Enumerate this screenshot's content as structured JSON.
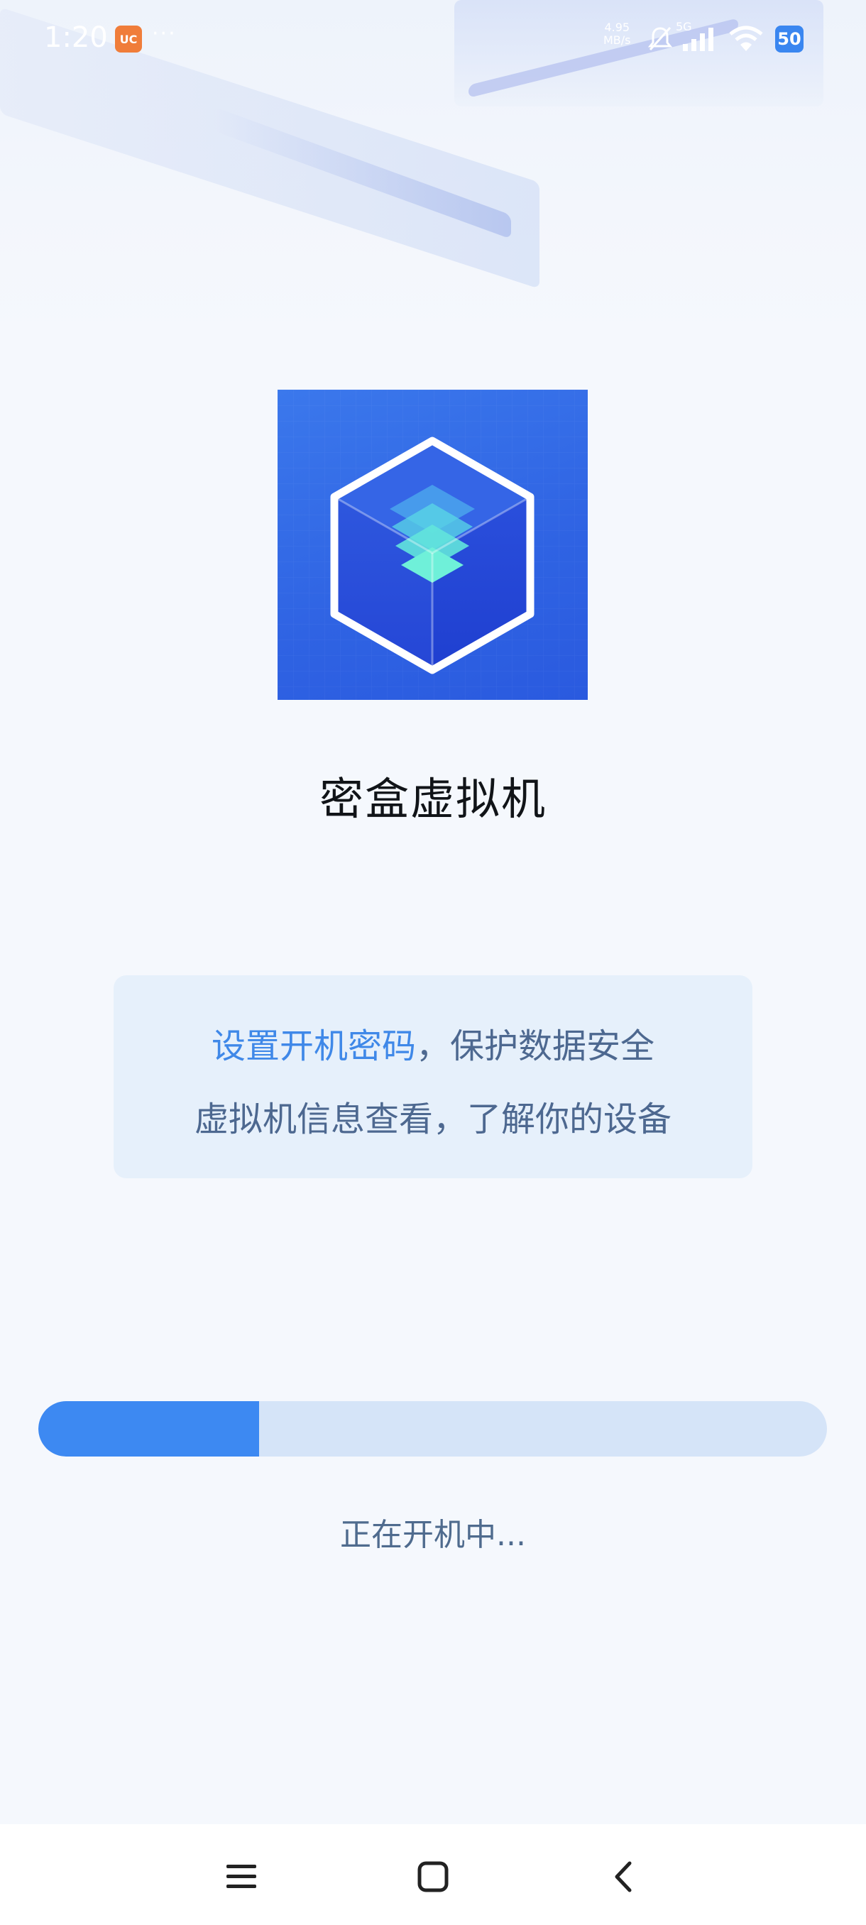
{
  "status_bar": {
    "time": "1:20",
    "app_badge_glyph": "UC",
    "more_dots": "···",
    "net_speed_value": "4.95",
    "net_speed_unit": "MB/s",
    "network_type": "5G",
    "battery_level": "50",
    "icons": [
      "app-notification-icon",
      "mute-icon",
      "signal-icon",
      "wifi-icon",
      "battery-icon"
    ]
  },
  "app": {
    "logo_icon": "cube-layers-icon",
    "name": "密盒虚拟机"
  },
  "info_card": {
    "line1_highlight": "设置开机密码",
    "line1_rest": "，保护数据安全",
    "line2": "虚拟机信息查看，了解你的设备"
  },
  "progress": {
    "fraction": 0.28,
    "status_text": "正在开机中..."
  },
  "nav_bar": {
    "icons": [
      "menu-icon",
      "home-icon",
      "back-icon"
    ]
  },
  "colors": {
    "accent": "#3d89f2",
    "background": "#f5f8fd",
    "card": "#e6f0fb",
    "track": "#d5e4f8",
    "logo_blue": "#2f63e3"
  }
}
